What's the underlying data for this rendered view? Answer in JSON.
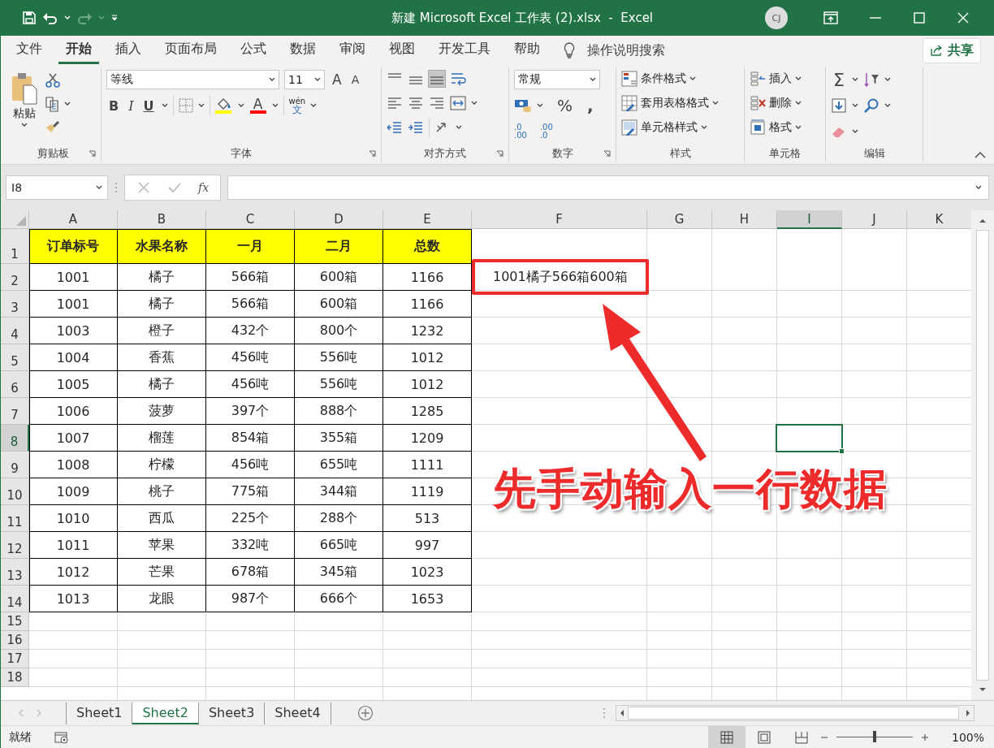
{
  "title_bar": {
    "title": "新建 Microsoft Excel 工作表 (2).xlsx  -  Excel",
    "avatar": "CJ"
  },
  "menu_tabs": [
    {
      "label": "文件",
      "selected": false
    },
    {
      "label": "开始",
      "selected": true
    },
    {
      "label": "插入",
      "selected": false
    },
    {
      "label": "页面布局",
      "selected": false
    },
    {
      "label": "公式",
      "selected": false
    },
    {
      "label": "数据",
      "selected": false
    },
    {
      "label": "审阅",
      "selected": false
    },
    {
      "label": "视图",
      "selected": false
    },
    {
      "label": "开发工具",
      "selected": false
    },
    {
      "label": "帮助",
      "selected": false
    }
  ],
  "tell_me": "操作说明搜索",
  "share": "共享",
  "ribbon": {
    "clipboard": {
      "paste": "粘贴",
      "label": "剪贴板"
    },
    "font": {
      "name": "等线",
      "size": "11",
      "grow": "A",
      "shrink": "A",
      "bold": "B",
      "italic": "I",
      "underline": "U",
      "font_color": "A",
      "phonetic_top": "wén",
      "phonetic_bottom": "文",
      "label": "字体"
    },
    "alignment": {
      "label": "对齐方式"
    },
    "number": {
      "format": "常规",
      "percent": "%",
      "comma": ",",
      "increase_top": ".0",
      "increase_bottom": ".00",
      "decrease_top": ".00",
      "decrease_bottom": ".0",
      "label": "数字"
    },
    "styles": {
      "items": [
        "条件格式",
        "套用表格格式",
        "单元格样式"
      ],
      "label": "样式"
    },
    "cells": {
      "items": [
        "插入",
        "删除",
        "格式"
      ],
      "label": "单元格"
    },
    "editing": {
      "sum": "Σ",
      "label": "编辑"
    }
  },
  "formula_bar": {
    "name_box": "I8",
    "fx": "fx"
  },
  "sheet": {
    "columns": [
      {
        "label": "A",
        "selected": false
      },
      {
        "label": "B",
        "selected": false
      },
      {
        "label": "C",
        "selected": false
      },
      {
        "label": "D",
        "selected": false
      },
      {
        "label": "E",
        "selected": false
      },
      {
        "label": "F",
        "selected": false
      },
      {
        "label": "G",
        "selected": false
      },
      {
        "label": "H",
        "selected": false
      },
      {
        "label": "I",
        "selected": true
      },
      {
        "label": "J",
        "selected": false
      },
      {
        "label": "K",
        "selected": false
      }
    ],
    "rows": [
      {
        "number": "1",
        "selected": false,
        "kind": "header",
        "cells": [
          "订单标号",
          "水果名称",
          "一月",
          "二月",
          "总数"
        ]
      },
      {
        "number": "2",
        "selected": false,
        "kind": "data",
        "cells": [
          "1001",
          "橘子",
          "566箱",
          "600箱",
          "1166",
          "1001橘子566箱600箱"
        ]
      },
      {
        "number": "3",
        "selected": false,
        "kind": "data",
        "cells": [
          "1001",
          "橘子",
          "566箱",
          "600箱",
          "1166"
        ]
      },
      {
        "number": "4",
        "selected": false,
        "kind": "data",
        "cells": [
          "1003",
          "橙子",
          "432个",
          "800个",
          "1232"
        ]
      },
      {
        "number": "5",
        "selected": false,
        "kind": "data",
        "cells": [
          "1004",
          "香蕉",
          "456吨",
          "556吨",
          "1012"
        ]
      },
      {
        "number": "6",
        "selected": false,
        "kind": "data",
        "cells": [
          "1005",
          "橘子",
          "456吨",
          "556吨",
          "1012"
        ]
      },
      {
        "number": "7",
        "selected": false,
        "kind": "data",
        "cells": [
          "1006",
          "菠萝",
          "397个",
          "888个",
          "1285"
        ]
      },
      {
        "number": "8",
        "selected": true,
        "kind": "data",
        "cells": [
          "1007",
          "榴莲",
          "854箱",
          "355箱",
          "1209"
        ]
      },
      {
        "number": "9",
        "selected": false,
        "kind": "data",
        "cells": [
          "1008",
          "柠檬",
          "456吨",
          "655吨",
          "1111"
        ]
      },
      {
        "number": "10",
        "selected": false,
        "kind": "data",
        "cells": [
          "1009",
          "桃子",
          "775箱",
          "344箱",
          "1119"
        ]
      },
      {
        "number": "11",
        "selected": false,
        "kind": "data",
        "cells": [
          "1010",
          "西瓜",
          "225个",
          "288个",
          "513"
        ]
      },
      {
        "number": "12",
        "selected": false,
        "kind": "data",
        "cells": [
          "1011",
          "苹果",
          "332吨",
          "665吨",
          "997"
        ]
      },
      {
        "number": "13",
        "selected": false,
        "kind": "data",
        "cells": [
          "1012",
          "芒果",
          "678箱",
          "345箱",
          "1023"
        ]
      },
      {
        "number": "14",
        "selected": false,
        "kind": "data",
        "cells": [
          "1013",
          "龙眼",
          "987个",
          "666个",
          "1653"
        ]
      },
      {
        "number": "15",
        "selected": false,
        "kind": "empty",
        "cells": []
      },
      {
        "number": "16",
        "selected": false,
        "kind": "empty",
        "cells": []
      },
      {
        "number": "17",
        "selected": false,
        "kind": "empty",
        "cells": []
      },
      {
        "number": "18",
        "selected": false,
        "kind": "empty",
        "cells": []
      }
    ],
    "annotation": "先手动输入一行数据"
  },
  "sheet_tabs": [
    {
      "label": "Sheet1",
      "selected": false
    },
    {
      "label": "Sheet2",
      "selected": true
    },
    {
      "label": "Sheet3",
      "selected": false
    },
    {
      "label": "Sheet4",
      "selected": false
    }
  ],
  "status_bar": {
    "status": "就绪",
    "zoom": {
      "level": 0.5,
      "reading": "100%"
    }
  }
}
